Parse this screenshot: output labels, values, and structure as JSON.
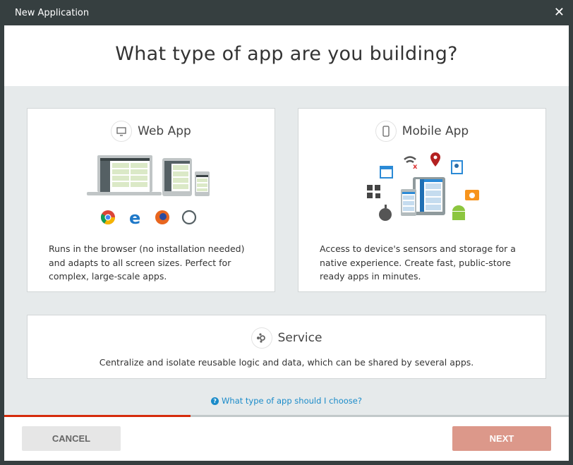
{
  "window": {
    "title": "New Application",
    "close_icon": "close-icon"
  },
  "header": {
    "title": "What type of app are you building?"
  },
  "options": [
    {
      "title": "Web App",
      "icon": "monitor-icon",
      "description": "Runs in the browser (no installation needed) and adapts to all screen sizes. Perfect for complex, large-scale apps.",
      "browser_icons": [
        "chrome-icon",
        "edge-icon",
        "firefox-icon",
        "safari-icon"
      ]
    },
    {
      "title": "Mobile App",
      "icon": "smartphone-icon",
      "description": "Access to device's sensors and storage for a native experience. Create fast, public-store ready apps in minutes.",
      "feature_icons": [
        "calendar-icon",
        "wifi-off-icon",
        "location-pin-icon",
        "contacts-icon",
        "qr-code-icon",
        "camera-icon",
        "apple-icon",
        "android-icon"
      ]
    },
    {
      "title": "Service",
      "icon": "service-nodes-icon",
      "description": "Centralize and isolate reusable logic and data, which can be shared by several apps."
    }
  ],
  "help_link": "What type of app should I choose?",
  "progress_percent": 33,
  "colors": {
    "accent": "#d52b0b",
    "next_disabled": "#dc988a",
    "link": "#1a8bc9"
  },
  "footer": {
    "cancel_label": "CANCEL",
    "next_label": "NEXT"
  }
}
